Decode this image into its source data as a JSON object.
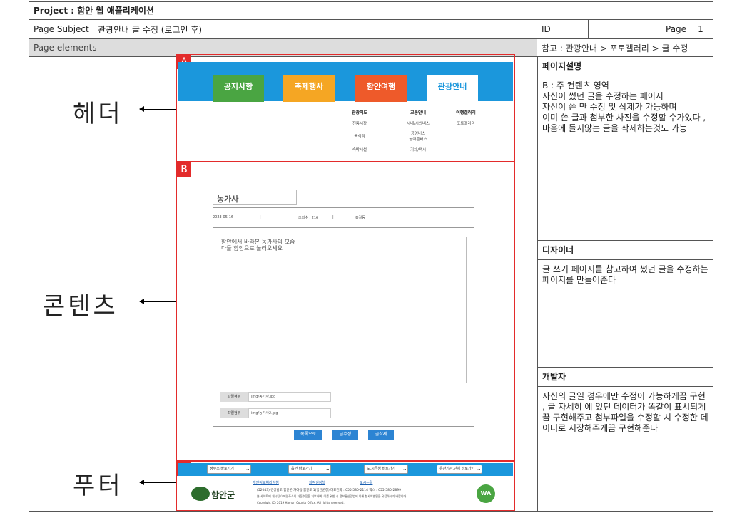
{
  "project": "Project : 함안 웹 애플리케이션",
  "page_subject_label": "Page Subject",
  "page_subject": "관광안내 글 수정 (로그인 후)",
  "id_label": "ID",
  "id_value": "",
  "page_label": "Page",
  "page_number": "1",
  "page_elements_label": "Page elements",
  "reference": "참고 : 관광안내 > 포토갤러리 > 글 수정",
  "labels": {
    "header": "헤더",
    "content": "콘텐츠",
    "footer": "푸터"
  },
  "section_tags": {
    "a": "A",
    "b": "B",
    "c": "C"
  },
  "side": {
    "desc_title": "페이지설명",
    "desc_lines": [
      "B : 주 컨텐츠 영역",
      "자신이 썼던 글을 수정하는 페이지",
      "자신이 쓴 만 수정 및 삭제가 가능하며",
      "이미 쓴 글과 첨부한 사진을 수정할 수가있다 ,마음에 들지않는 글을 삭제하는것도 가능"
    ],
    "designer_title": "디자이너",
    "designer_text": "글 쓰기 페이지를 참고하여 썼던 글을 수정하는 페이지를 만들어준다",
    "dev_title": "개발자",
    "dev_text": "자신의 글일 경우에만 수정이 가능하게끔 구현 , 글 자세히 에 있던 데이터가 똑같이 표시되게끔 구현해주고 첨부파일을 수정할 시 수정한 데이터로 저장해주게끔 구현해준다"
  },
  "header": {
    "tabs": [
      {
        "label": "공지사항",
        "color": "#4aa542"
      },
      {
        "label": "축제행사",
        "color": "#f5a623"
      },
      {
        "label": "함안여행",
        "color": "#ee5a2a"
      },
      {
        "label": "관광안내",
        "color": "#ffffff"
      }
    ],
    "menu": {
      "col1": [
        "관광지도",
        "전통시장",
        "음식점",
        "숙박시설"
      ],
      "col2": [
        "교통안내",
        "시내/시외버스",
        "공영버스",
        "농어촌버스",
        "기차/택시"
      ],
      "col3": [
        "여행갤러리",
        "포토갤러리"
      ]
    }
  },
  "content": {
    "title": "농가사",
    "date": "2023-05-16",
    "views": "조회수 : 216",
    "author": "홍길동",
    "body": [
      "함안에서 바라본 농가사의 모습",
      "다들 함안으로 놀러오세요"
    ],
    "attach_label": "파일첨부",
    "attach1": "img/농가사.jpg",
    "attach2": "img/농가사2.jpg",
    "btn_list": "목록으로",
    "btn_edit": "글수정",
    "btn_delete": "글삭제"
  },
  "footer": {
    "selects": [
      "정부소 바로가기",
      "읍면 바로가기",
      "도,시군청 바로가기",
      "유관기관,단체 바로가기"
    ],
    "links": [
      "개인정보처리방침",
      "저작권정책",
      "오시는길"
    ],
    "address": "(52043) 경상남도 함안군 가야읍 함안로 1(함안군청)   대표전화 : 055-580-2114   팩스 : 055-580-2899",
    "notice": "본 사이트에 게시된 이메일주소의 자동수집을 거부하며, 이를 위반 시 정보통신망법에 의해 형사처벌됨을 유념하시기 바랍니다.",
    "copyright": "Copyright (C) 2019 Haman County Office. All rights reserved.",
    "logo_text": "함안군",
    "badge_text": "WA"
  }
}
